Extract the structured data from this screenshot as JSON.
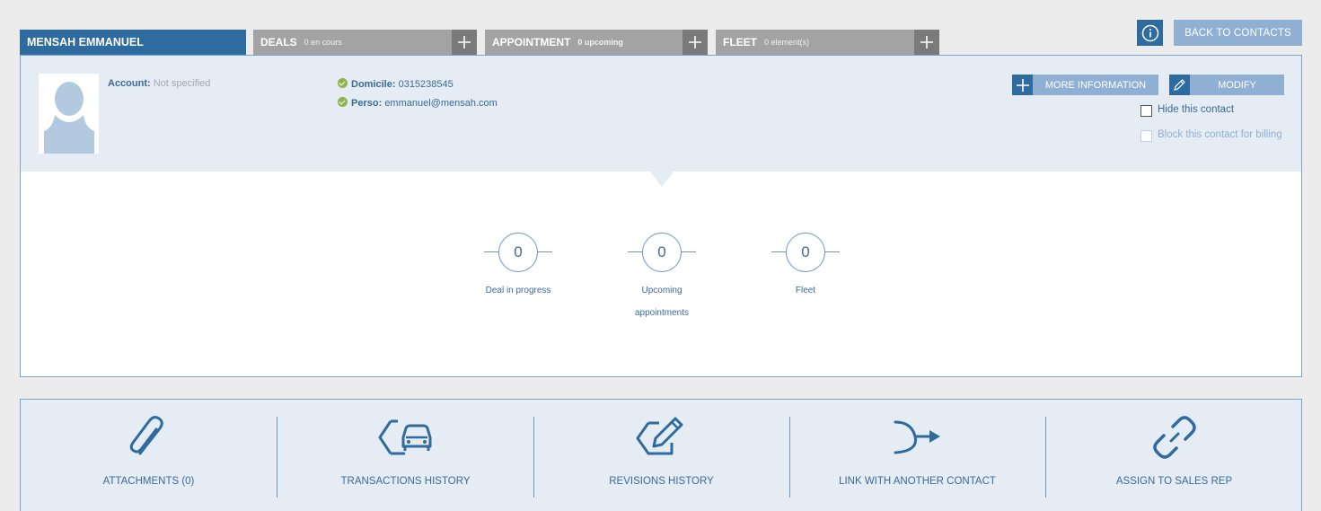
{
  "header": {
    "info_icon": "info-circle-icon",
    "back_label": "BACK TO CONTACTS"
  },
  "tabs": {
    "contact_name": "MENSAH EMMANUEL",
    "deals": {
      "label": "DEALS",
      "sub": "0 en cours"
    },
    "appointment": {
      "label": "APPOINTMENT",
      "sub": "0 upcoming"
    },
    "fleet": {
      "label": "FLEET",
      "sub": "0 element(s)"
    }
  },
  "contact": {
    "account_label": "Account:",
    "account_value": "Not specified",
    "domicile_label": "Domicile:",
    "domicile_value": "0315238545",
    "perso_label": "Perso:",
    "perso_value": "emmanuel@mensah.com"
  },
  "actions": {
    "more_info": "MORE INFORMATION",
    "modify": "MODIFY",
    "hide_contact": "Hide this contact",
    "block_billing": "Block this contact for billing"
  },
  "stats": [
    {
      "value": "0",
      "label": "Deal in progress"
    },
    {
      "value": "0",
      "label": "Upcoming appointments"
    },
    {
      "value": "0",
      "label": "Fleet"
    }
  ],
  "tools": {
    "attachments": "ATTACHMENTS (0)",
    "transactions": "TRANSACTIONS HISTORY",
    "revisions": "REVISIONS HISTORY",
    "link_contact": "LINK WITH ANOTHER CONTACT",
    "assign_rep": "ASSIGN TO SALES REP"
  },
  "colors": {
    "primary": "#2e6b9e",
    "light_button": "#8fb0d3",
    "panel_bg": "#e6ecf3",
    "tab_gray": "#a3a3a3",
    "success": "#8db34a"
  }
}
